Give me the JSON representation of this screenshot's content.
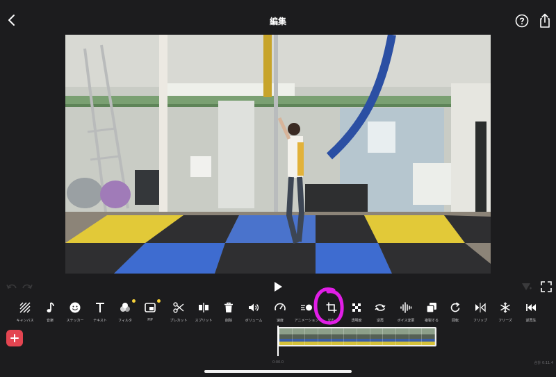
{
  "header": {
    "title": "編集"
  },
  "toolbar": {
    "tools": [
      {
        "id": "canvas",
        "label": "キャンバス",
        "icon": "canvas-icon"
      },
      {
        "id": "music",
        "label": "音楽",
        "icon": "music-note-icon"
      },
      {
        "id": "sticker",
        "label": "ステッカー",
        "icon": "smiley-icon"
      },
      {
        "id": "text",
        "label": "テキスト",
        "icon": "text-t-icon"
      },
      {
        "id": "filter",
        "label": "フィルタ",
        "icon": "filter-circles-icon"
      },
      {
        "id": "pip",
        "label": "PIP",
        "icon": "pip-icon"
      },
      {
        "id": "precut",
        "label": "プレカット",
        "icon": "scissors-icon"
      },
      {
        "id": "split",
        "label": "スプリット",
        "icon": "split-icon"
      },
      {
        "id": "delete",
        "label": "削除",
        "icon": "trash-icon"
      },
      {
        "id": "volume",
        "label": "ボリューム",
        "icon": "speaker-icon"
      },
      {
        "id": "speed",
        "label": "速度",
        "icon": "speedometer-icon"
      },
      {
        "id": "animation",
        "label": "アニメーション",
        "icon": "animation-icon"
      },
      {
        "id": "crop",
        "label": "切り",
        "icon": "crop-icon"
      },
      {
        "id": "opacity",
        "label": "透明度",
        "icon": "checkerboard-icon"
      },
      {
        "id": "reverse",
        "label": "逆再",
        "icon": "reverse-icon"
      },
      {
        "id": "voice",
        "label": "ボイス変更",
        "icon": "waveform-icon"
      },
      {
        "id": "duplicate",
        "label": "複製する",
        "icon": "duplicate-icon"
      },
      {
        "id": "rotate",
        "label": "回転",
        "icon": "rotate-icon"
      },
      {
        "id": "flip",
        "label": "フリップ",
        "icon": "flip-icon"
      },
      {
        "id": "freeze",
        "label": "フリーズ",
        "icon": "snowflake-icon"
      },
      {
        "id": "rewind",
        "label": "逆再生",
        "icon": "rewind-icon"
      }
    ],
    "badges": [
      "filter",
      "pip"
    ]
  },
  "timeline": {
    "current_time": "0:00.0",
    "total_time": "合計 0:11.4"
  },
  "colors": {
    "background": "#1c1c1e",
    "add_button": "#e34551",
    "badge": "#f7d23a",
    "annotation": "#e11ee6"
  }
}
